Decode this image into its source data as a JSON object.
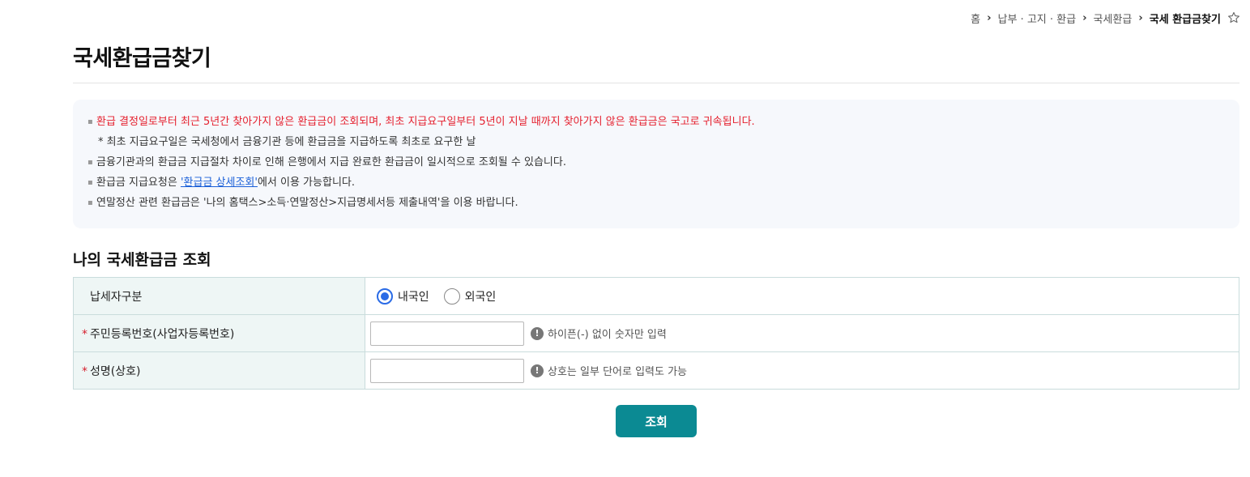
{
  "breadcrumb": {
    "items": [
      "홈",
      "납부 · 고지 · 환급",
      "국세환급"
    ],
    "current": "국세 환급금찾기",
    "separator": "›"
  },
  "page": {
    "title": "국세환급금찾기"
  },
  "notice": {
    "red_line": "환급 결정일로부터 최근 5년간 찾아가지 않은 환급금이 조회되며, 최초 지급요구일부터 5년이 지날 때까지 찾아가지 않은 환급금은 국고로 귀속됩니다.",
    "sub_line": "* 최초 지급요구일은 국세청에서 금융기관 등에 환급금을 지급하도록 최초로 요구한 날",
    "line2": "금융기관과의 환급금 지급절차 차이로 인해 은행에서 지급 완료한 환급금이 일시적으로 조회될 수 있습니다.",
    "line3_prefix": "환급금 지급요청은 ",
    "line3_link": "'환급금 상세조회'",
    "line3_suffix": "에서 이용 가능합니다.",
    "line4": "연말정산 관련 환급금은 '나의 홈택스>소득·연말정산>지급명세서등 제출내역'을 이용 바랍니다."
  },
  "section": {
    "title": "나의 국세환급금 조회"
  },
  "form": {
    "taxpayer_type_label": "납세자구분",
    "radio_domestic": "내국인",
    "radio_foreign": "외국인",
    "selected": "내국인",
    "required_mark": "*",
    "id_label": "주민등록번호(사업자등록번호)",
    "id_value": "",
    "id_hint": "하이픈(-) 없이 숫자만 입력",
    "name_label": "성명(상호)",
    "name_value": "",
    "name_hint": "상호는 일부 단어로 입력도 가능",
    "info_icon_glyph": "!"
  },
  "actions": {
    "search_label": "조회"
  },
  "colors": {
    "accent": "#0b8a93",
    "notice_red": "#e5202e",
    "radio_selected": "#2a6be6",
    "label_bg": "#eef6f5"
  }
}
